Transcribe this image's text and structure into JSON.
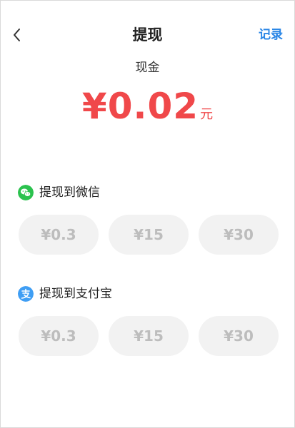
{
  "header": {
    "title": "提现",
    "records_label": "记录"
  },
  "balance": {
    "label": "现金",
    "amount": "¥0.02",
    "unit": "元"
  },
  "wechat": {
    "title": "提现到微信",
    "icon": "wechat-icon",
    "color": "#2bc24e",
    "options": [
      "¥0.3",
      "¥15",
      "¥30"
    ]
  },
  "alipay": {
    "title": "提现到支付宝",
    "icon": "alipay-icon",
    "color": "#3f9ef4",
    "options": [
      "¥0.3",
      "¥15",
      "¥30"
    ]
  },
  "colors": {
    "accent_red": "#f0484a",
    "link_blue": "#2a86e6",
    "chip_bg": "#f2f2f2",
    "chip_text": "#bdbdbd"
  }
}
